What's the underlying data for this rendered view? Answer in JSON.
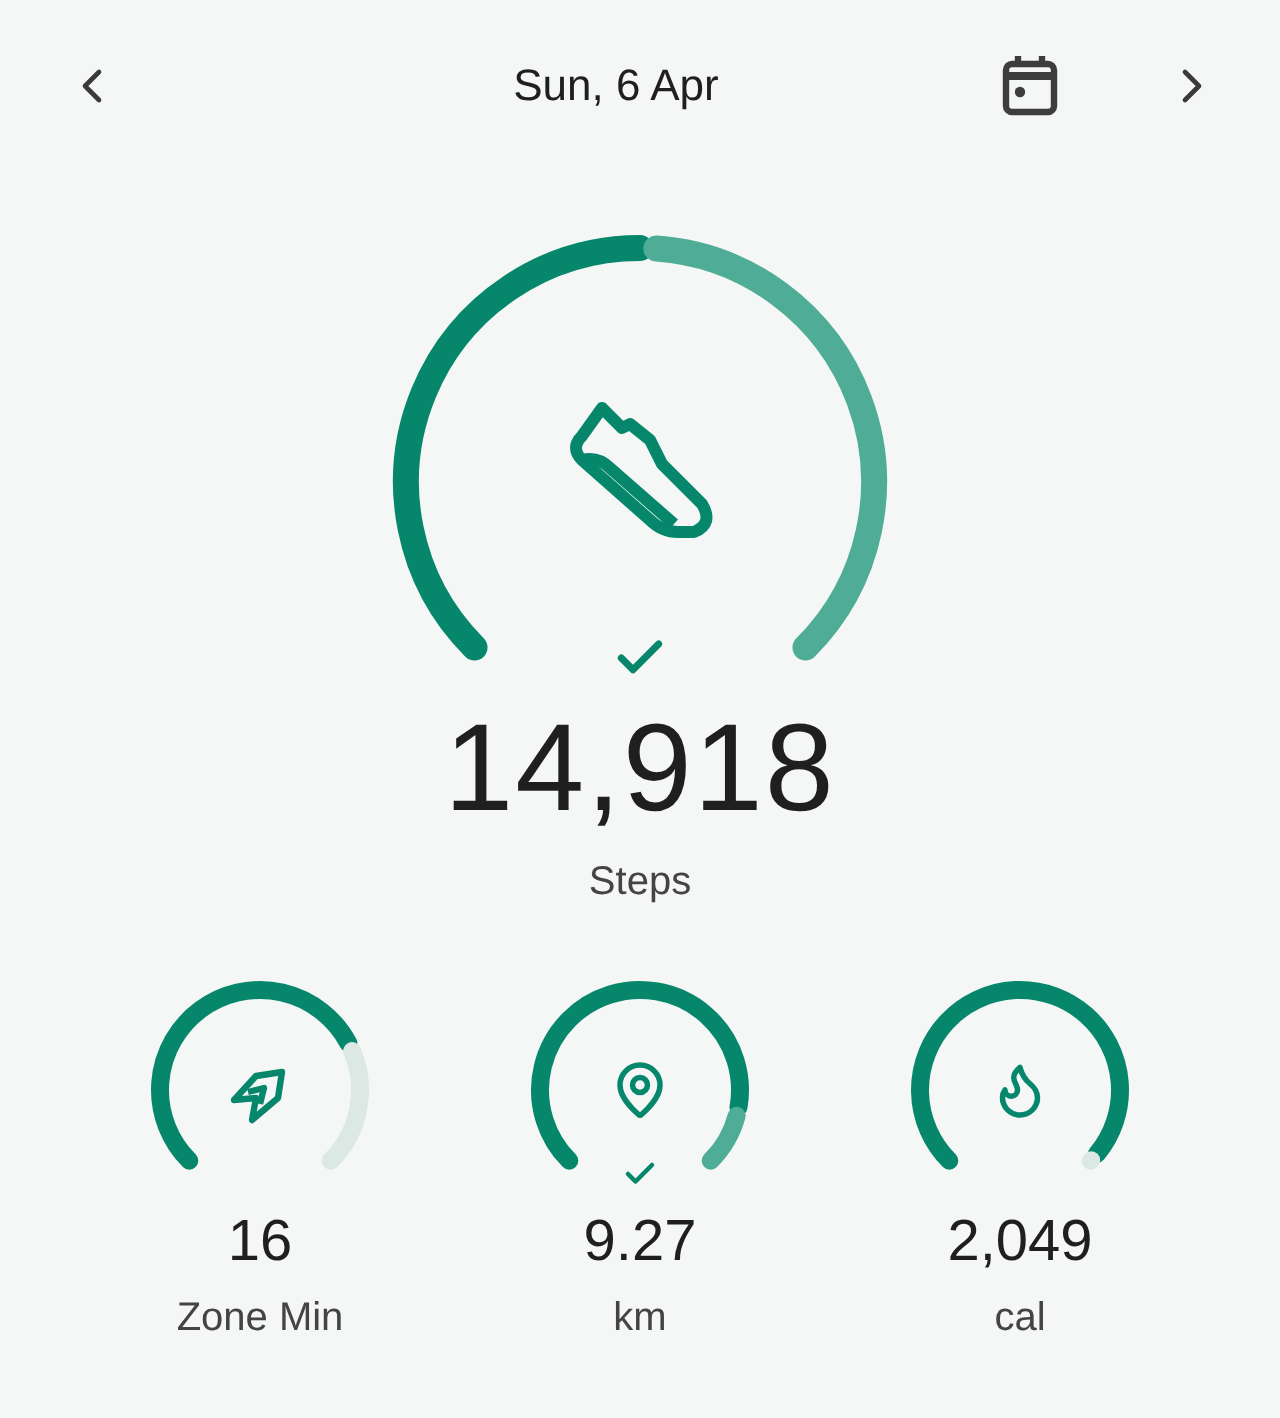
{
  "header": {
    "date": "Sun, 6 Apr"
  },
  "steps": {
    "value": "14,918",
    "label": "Steps",
    "goal_met": true
  },
  "metrics": [
    {
      "kind": "zone",
      "value": "16",
      "label": "Zone Min",
      "goal_met": false
    },
    {
      "kind": "distance",
      "value": "9.27",
      "label": "km",
      "goal_met": true
    },
    {
      "kind": "energy",
      "value": "2,049",
      "label": "cal",
      "goal_met": false
    }
  ]
}
